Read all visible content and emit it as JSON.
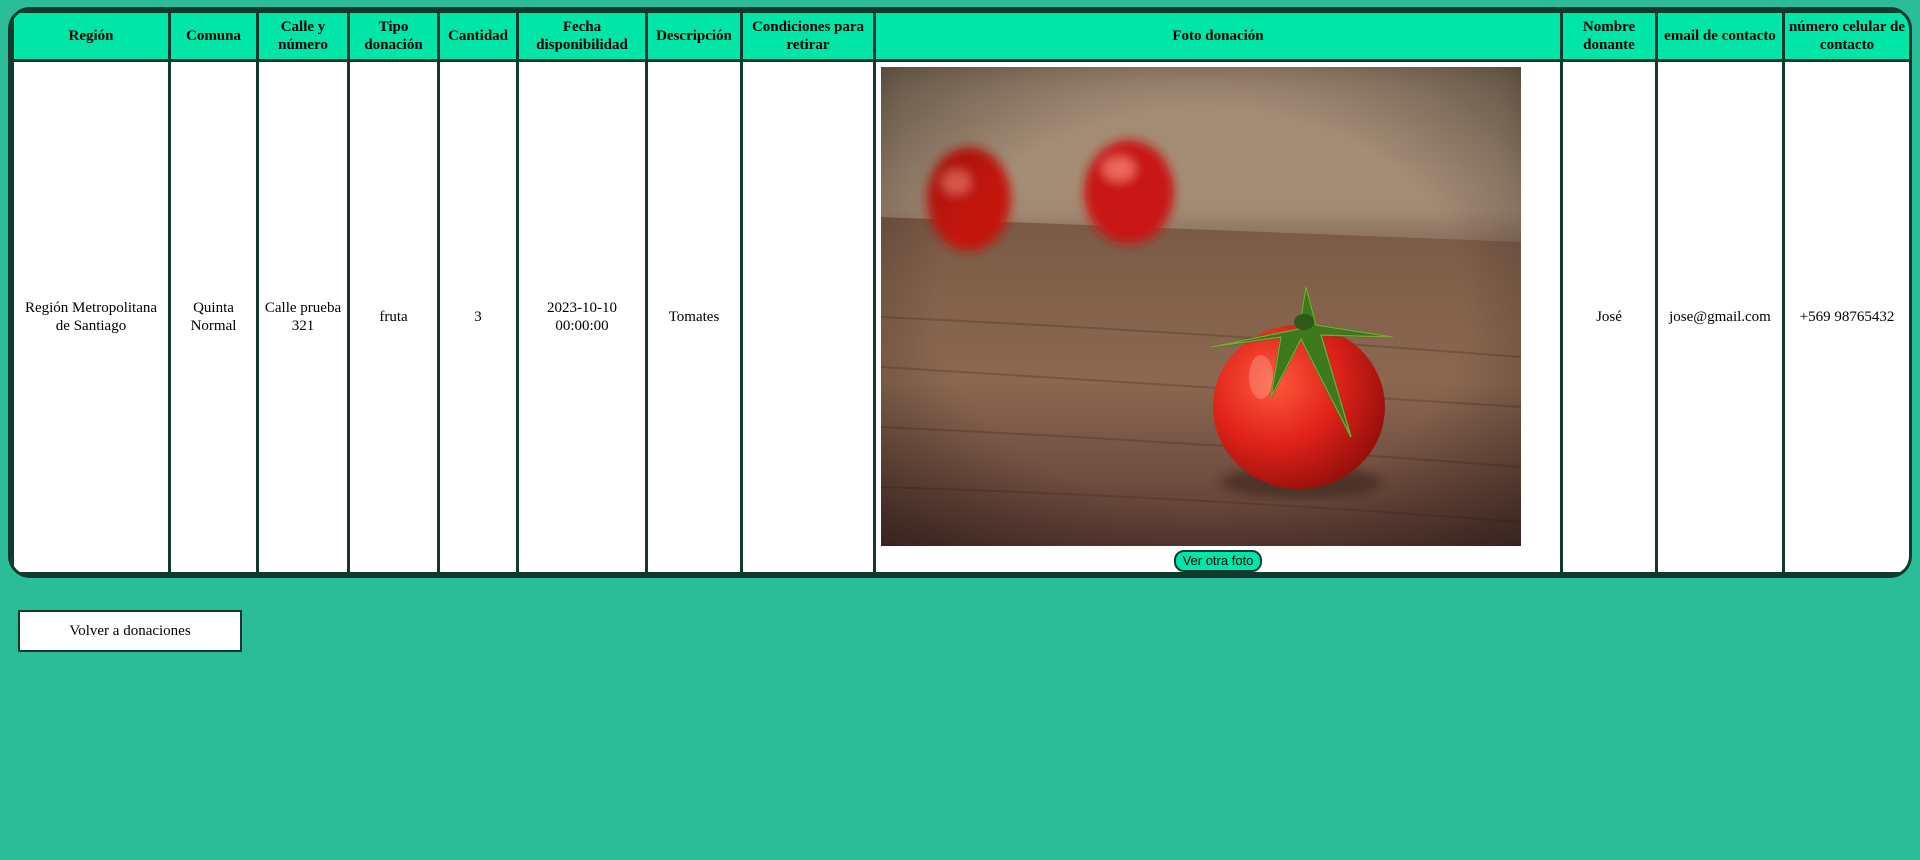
{
  "table": {
    "headers": [
      "Región",
      "Comuna",
      "Calle y número",
      "Tipo donación",
      "Cantidad",
      "Fecha disponibilidad",
      "Descripción",
      "Condiciones para retirar",
      "Foto donación",
      "Nombre donante",
      "email de contacto",
      "número celular de contacto"
    ],
    "row": {
      "region": "Región Metropolitana de Santiago",
      "comuna": "Quinta Normal",
      "calle": "Calle prueba 321",
      "tipo": "fruta",
      "cantidad": "3",
      "fecha": "2023-10-10 00:00:00",
      "descripcion": "Tomates",
      "condiciones": "",
      "nombre": "José",
      "email": "jose@gmail.com",
      "celular": "+569 98765432"
    },
    "photo_button": "Ver otra foto"
  },
  "back_button": "Volver a donaciones",
  "colors": {
    "background": "#2abd97",
    "header": "#00e5a8",
    "border": "#113a2c"
  }
}
